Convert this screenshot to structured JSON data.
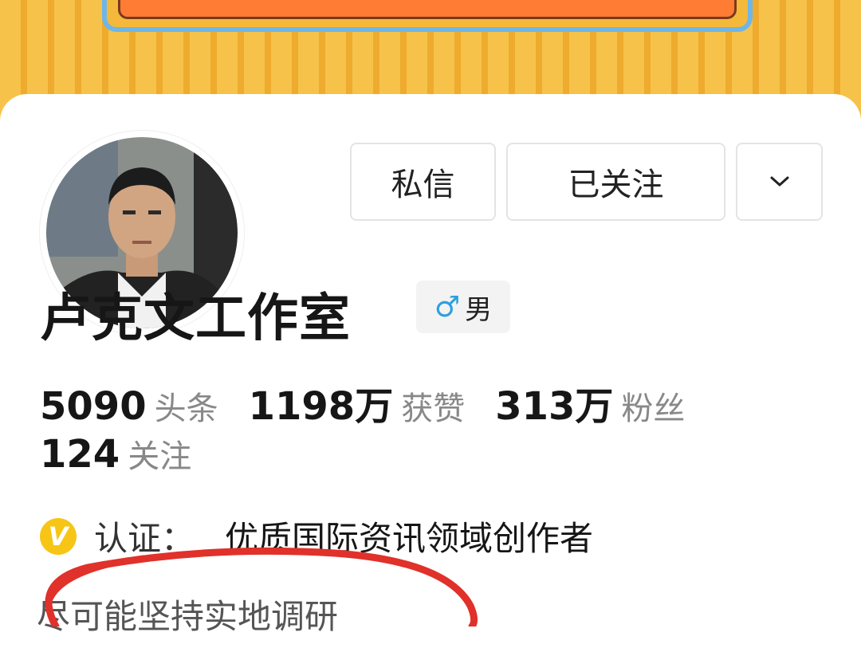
{
  "profile": {
    "name": "卢克文工作室",
    "gender_symbol": "♂",
    "gender_label": "男"
  },
  "actions": {
    "message_label": "私信",
    "follow_label": "已关注",
    "more_icon": "chevron-down-icon"
  },
  "stats": {
    "posts": {
      "value": "5090",
      "label": "头条"
    },
    "likes": {
      "value": "1198万",
      "label": "获赞"
    },
    "fans": {
      "value": "313万",
      "label": "粉丝"
    },
    "following": {
      "value": "124",
      "label": "关注"
    }
  },
  "verification": {
    "badge": "V",
    "label": "认证：",
    "value": "优质国际资讯领域创作者"
  },
  "bio": "尽可能坚持实地调研",
  "colors": {
    "accent_yellow": "#f7c515",
    "gender_blue": "#2e9fe0",
    "annotation_red": "#e0312a"
  }
}
